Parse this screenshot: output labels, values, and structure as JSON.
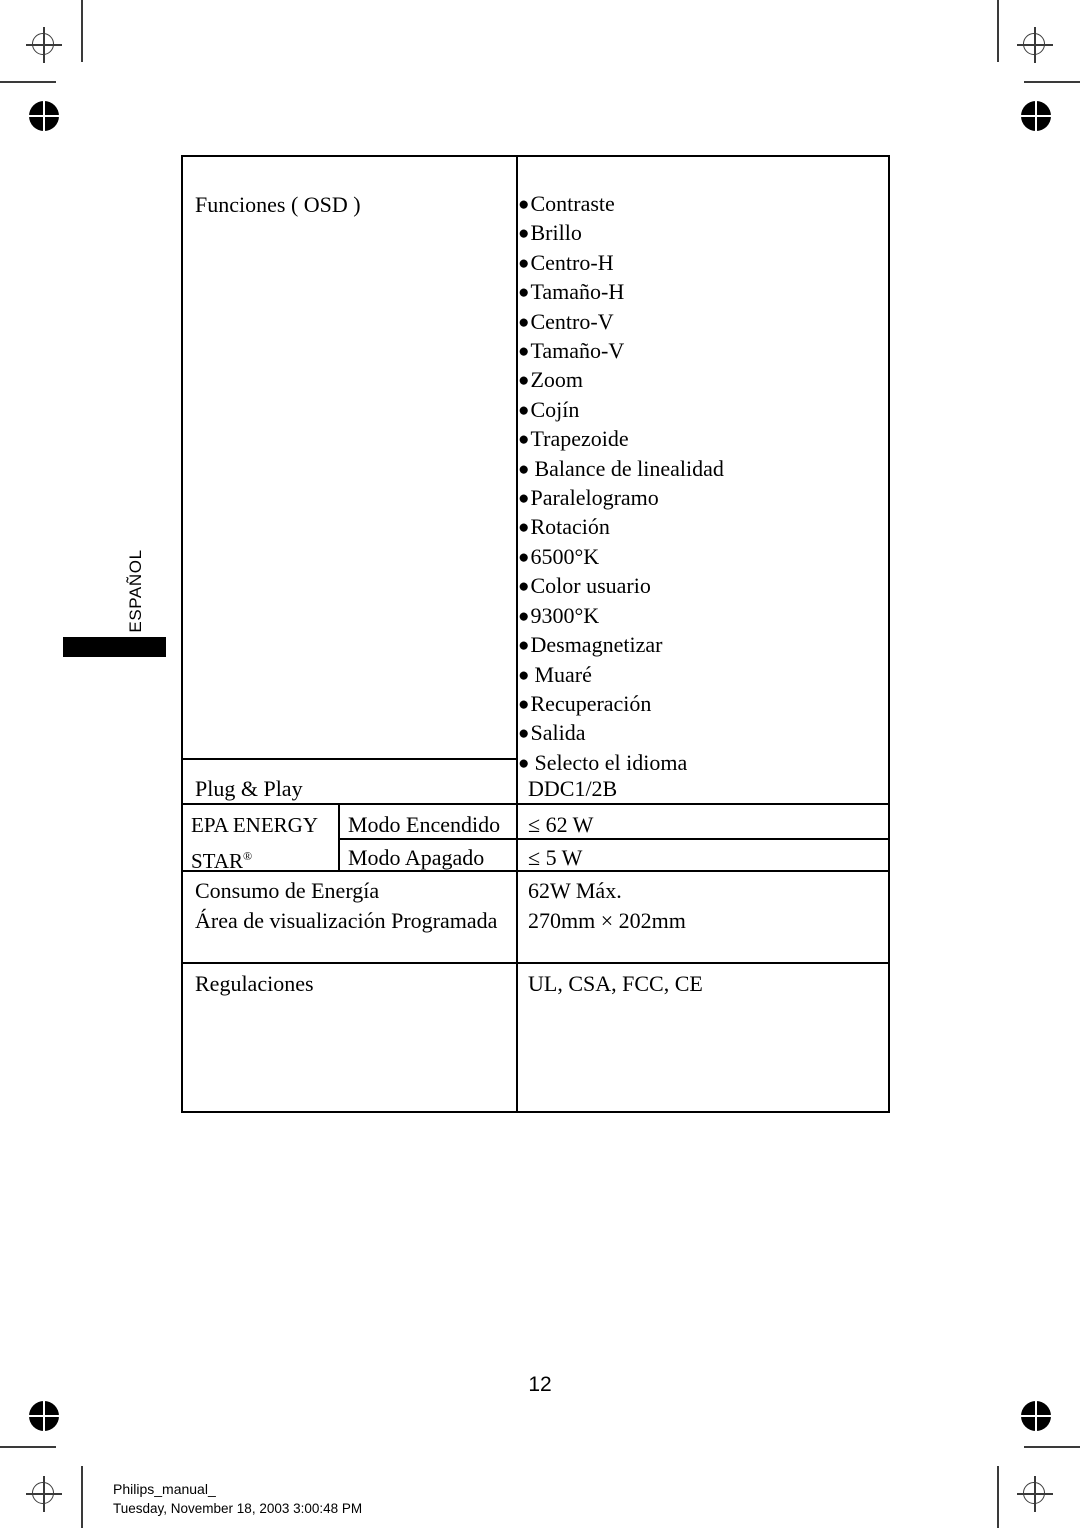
{
  "document": {
    "page_number": "12",
    "language_tab": "ESPAÑOL"
  },
  "footer": {
    "file_name": "Philips_manual_",
    "timestamp": "Tuesday, November 18, 2003 3:00:48 PM"
  },
  "spec_table": {
    "osd": {
      "label": "Funciones ( OSD )",
      "items": [
        "Contraste",
        "Brillo",
        "Centro-H",
        "Tamaño-H",
        "Centro-V",
        "Tamaño-V",
        "Zoom",
        "Cojín",
        "Trapezoide",
        "Balance de linealidad",
        "Paralelogramo",
        "Rotación",
        "6500°K",
        "Color usuario",
        "9300°K",
        "Desmagnetizar",
        "Muaré",
        "Recuperación",
        "Salida",
        "Selecto el idioma"
      ]
    },
    "plug_and_play": {
      "label": "Plug & Play",
      "value": "DDC1/2B"
    },
    "energy_star": {
      "label_line1": "EPA ENERGY",
      "label_line2": "STAR",
      "label_superscript": "®",
      "rows": [
        {
          "mode": "Modo Encendido",
          "value": "≤ 62 W"
        },
        {
          "mode": "Modo Apagado",
          "value": "≤ 5 W"
        }
      ]
    },
    "power": {
      "label_line1": "Consumo de Energía",
      "label_line2": "Área de visualización Programada",
      "value_line1": "62W Máx.",
      "value_line2": "270mm × 202mm"
    },
    "regulations": {
      "label": "Regulaciones",
      "value": "UL, CSA, FCC, CE"
    }
  },
  "print_marks": {
    "bullet_glyph": "●",
    "registration_target": "registration-target",
    "registration_dot": "registration-dot"
  }
}
